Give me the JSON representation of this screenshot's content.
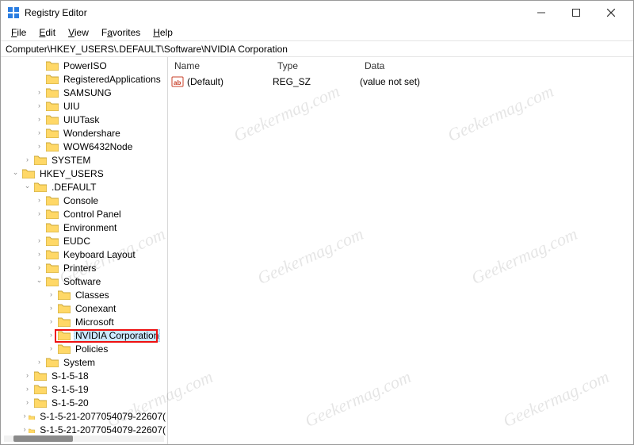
{
  "window": {
    "title": "Registry Editor"
  },
  "menu": {
    "file": "File",
    "edit": "Edit",
    "view": "View",
    "favorites": "Favorites",
    "help": "Help"
  },
  "address": "Computer\\HKEY_USERS\\.DEFAULT\\Software\\NVIDIA Corporation",
  "tree": {
    "n0": "PowerISO",
    "n1": "RegisteredApplications",
    "n2": "SAMSUNG",
    "n3": "UIU",
    "n4": "UIUTask",
    "n5": "Wondershare",
    "n6": "WOW6432Node",
    "n7": "SYSTEM",
    "n8": "HKEY_USERS",
    "n9": ".DEFAULT",
    "n10": "Console",
    "n11": "Control Panel",
    "n12": "Environment",
    "n13": "EUDC",
    "n14": "Keyboard Layout",
    "n15": "Printers",
    "n16": "Software",
    "n17": "Classes",
    "n18": "Conexant",
    "n19": "Microsoft",
    "n20": "NVIDIA Corporation",
    "n21": "Policies",
    "n22": "System",
    "n23": "S-1-5-18",
    "n24": "S-1-5-19",
    "n25": "S-1-5-20",
    "n26": "S-1-5-21-2077054079-22607(",
    "n27": "S-1-5-21-2077054079-22607("
  },
  "list": {
    "headers": {
      "name": "Name",
      "type": "Type",
      "data": "Data"
    },
    "rows": [
      {
        "name": "(Default)",
        "type": "REG_SZ",
        "data": "(value not set)"
      }
    ]
  },
  "watermark": "Geekermag.com"
}
